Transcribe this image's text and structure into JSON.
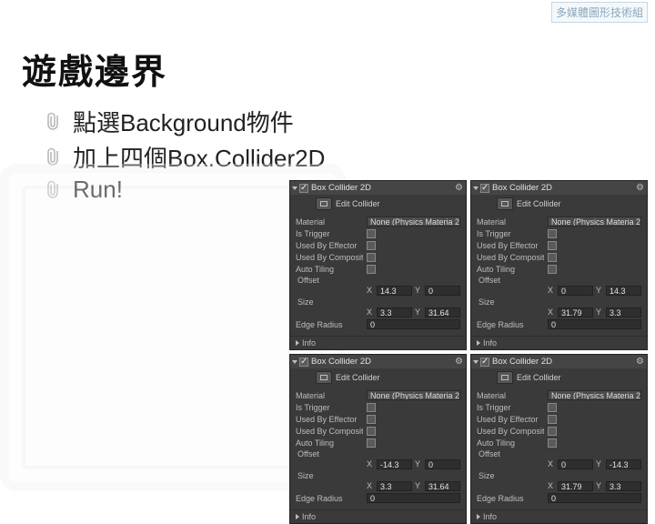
{
  "badge": "多媒體圖形技術組",
  "title": "遊戲邊界",
  "bullets": [
    "點選Background物件",
    "加上四個Box.Collider2D",
    "Run!"
  ],
  "panel_header": {
    "title": "Box Collider 2D",
    "edit": "Edit Collider"
  },
  "labels": {
    "material": "Material",
    "isTrigger": "Is Trigger",
    "usedByEffector": "Used By Effector",
    "usedByComposite": "Used By Composite",
    "autoTiling": "Auto Tiling",
    "offset": "Offset",
    "size": "Size",
    "edgeRadius": "Edge Radius",
    "info": "Info",
    "materialValue": "None (Physics Materia 2"
  },
  "panels": [
    {
      "offset": {
        "x": "14.3",
        "y": "0"
      },
      "size": {
        "x": "3.3",
        "y": "31.64"
      },
      "edgeRadius": "0"
    },
    {
      "offset": {
        "x": "0",
        "y": "14.3"
      },
      "size": {
        "x": "31.79",
        "y": "3.3"
      },
      "edgeRadius": "0"
    },
    {
      "offset": {
        "x": "-14.3",
        "y": "0"
      },
      "size": {
        "x": "3.3",
        "y": "31.64"
      },
      "edgeRadius": "0"
    },
    {
      "offset": {
        "x": "0",
        "y": "-14.3"
      },
      "size": {
        "x": "31.79",
        "y": "3.3"
      },
      "edgeRadius": "0"
    }
  ]
}
